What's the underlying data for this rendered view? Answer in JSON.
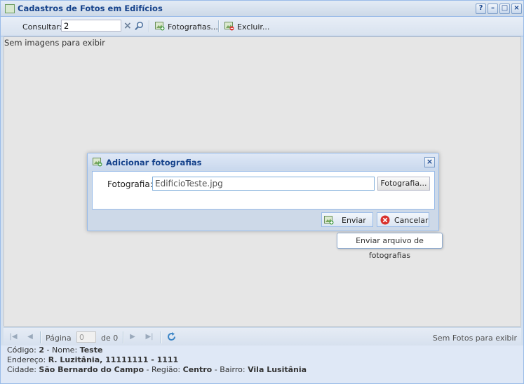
{
  "window": {
    "title": "Cadastros de Fotos em Edifícios",
    "buttons": [
      "?",
      "–",
      "□",
      "×"
    ]
  },
  "toolbar": {
    "consult_label": "Consultar:",
    "search_value": "2",
    "clear_symbol": "×",
    "photos_label": "Fotografias...",
    "delete_label": "Excluir..."
  },
  "content": {
    "empty_text": "Sem imagens para exibir"
  },
  "paging": {
    "page_label": "Página",
    "page_value": "0",
    "of_label": "de 0",
    "status_text": "Sem Fotos para exibir"
  },
  "info": {
    "line1": {
      "code_label": "Código:",
      "code_value": "2",
      "name_label": "- Nome:",
      "name_value": "Teste"
    },
    "line2": {
      "address_label": "Endereço:",
      "address_value": "R. Luzitânia, 11111111 - 1111"
    },
    "line3": {
      "city_label": "Cidade:",
      "city_value": "São Bernardo do Campo",
      "region_label": "- Região:",
      "region_value": "Centro",
      "district_label": "- Bairro:",
      "district_value": "Vila Lusitânia"
    }
  },
  "dialog": {
    "title": "Adicionar fotografias",
    "field_label": "Fotografia:",
    "field_value": "EdificioTeste.jpg",
    "browse_label": "Fotografia...",
    "send_label": "Enviar",
    "cancel_label": "Cancelar",
    "close_symbol": "×"
  },
  "tooltip": {
    "text": "Enviar arquivo de fotografias"
  },
  "colors": {
    "title_text": "#15428b",
    "border": "#99bbe8",
    "cancel_icon": "#d9302b"
  },
  "icons": [
    "window-icon",
    "search-icon",
    "add-photo-icon",
    "delete-photo-icon",
    "refresh-icon",
    "cancel-icon"
  ]
}
